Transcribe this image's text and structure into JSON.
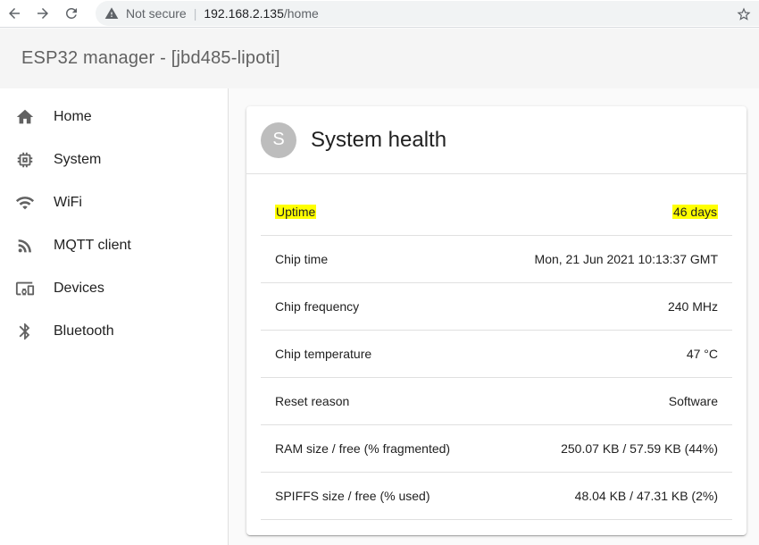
{
  "browser": {
    "security_label": "Not secure",
    "url_host": "192.168.2.135",
    "url_path": "/home"
  },
  "app": {
    "title": "ESP32 manager - [jbd485-lipoti]"
  },
  "sidebar": {
    "items": [
      {
        "label": "Home",
        "icon": "home-icon"
      },
      {
        "label": "System",
        "icon": "chip-icon"
      },
      {
        "label": "WiFi",
        "icon": "wifi-icon"
      },
      {
        "label": "MQTT client",
        "icon": "rss-icon"
      },
      {
        "label": "Devices",
        "icon": "devices-icon"
      },
      {
        "label": "Bluetooth",
        "icon": "bluetooth-icon"
      }
    ]
  },
  "card": {
    "avatar_letter": "S",
    "title": "System health",
    "rows": [
      {
        "label": "Uptime",
        "value": "46 days",
        "highlighted": true
      },
      {
        "label": "Chip time",
        "value": "Mon, 21 Jun 2021 10:13:37 GMT"
      },
      {
        "label": "Chip frequency",
        "value": "240 MHz"
      },
      {
        "label": "Chip temperature",
        "value": "47 °C"
      },
      {
        "label": "Reset reason",
        "value": "Software"
      },
      {
        "label": "RAM size / free (% fragmented)",
        "value": "250.07 KB / 57.59 KB (44%)"
      },
      {
        "label": "SPIFFS size / free (% used)",
        "value": "48.04 KB / 47.31 KB (2%)"
      }
    ]
  },
  "colors": {
    "highlight": "#ffff00",
    "avatar_bg": "#bdbdbd"
  }
}
